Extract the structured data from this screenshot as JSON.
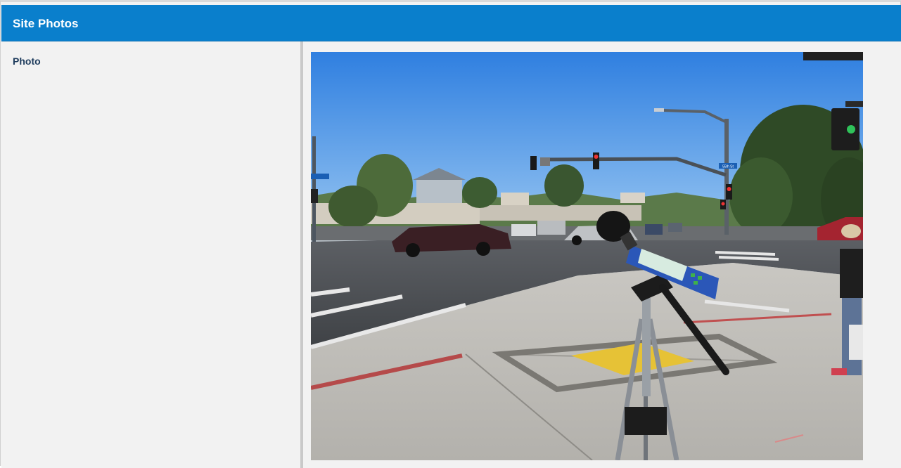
{
  "section": {
    "title": "Site Photos"
  },
  "field": {
    "label": "Photo",
    "photo_alt": "Site photo: sound level meter on tripod at street intersection",
    "street_sign_text": "55th St"
  },
  "colors": {
    "header_bg": "#0a7fcc",
    "header_text": "#ffffff",
    "label_text": "#1d3b5c",
    "panel_bg": "#f2f2f2"
  }
}
